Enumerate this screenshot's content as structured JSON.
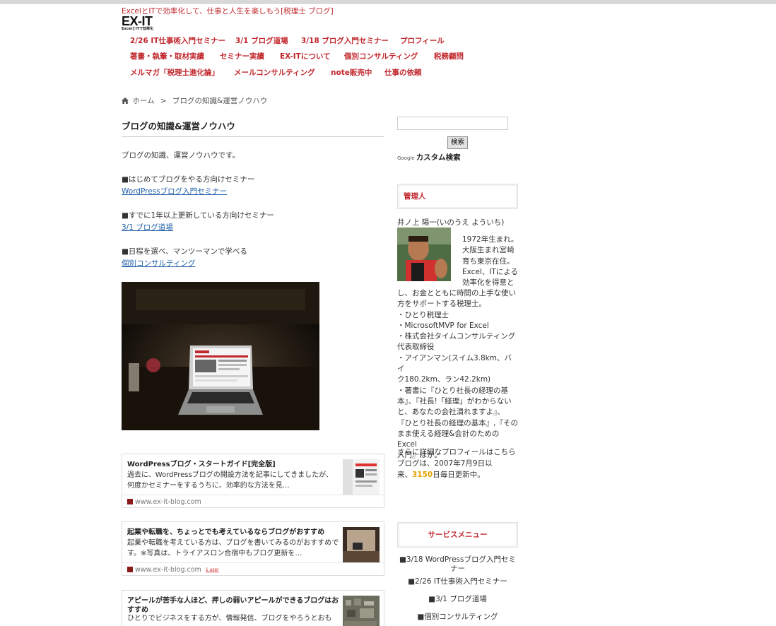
{
  "site": {
    "tagline": "ExcelとITで効率化して、仕事と人生を楽しもう[税理士 ブログ]",
    "logo_main": "EX-IT",
    "logo_sub": "ExcelとITで効率化"
  },
  "nav": {
    "row1": [
      "2/26 IT仕事術入門セミナー",
      "3/1 ブログ道場",
      "3/18 ブログ入門セミナー",
      "プロフィール"
    ],
    "row2": [
      "著書・執筆・取材実績",
      "セミナー実績",
      "EX-ITについて",
      "個別コンサルティング",
      "税務顧問"
    ],
    "row3": [
      "メルマガ「税理士進化論」",
      "メールコンサルティング",
      "note販売中",
      "仕事の依頼"
    ]
  },
  "breadcrumb": {
    "home": "ホーム",
    "separator": ">",
    "current": "ブログの知識&運営ノウハウ"
  },
  "article": {
    "title": "ブログの知識&運営ノウハウ",
    "intro": "ブログの知識、運営ノウハウです。",
    "sections": [
      {
        "heading": "■はじめてブログをやる方向けセミナー",
        "link": "WordPressブログ入門セミナー"
      },
      {
        "heading": "■すでに1年以上更新している方向けセミナー",
        "link": "3/1 ブログ道場"
      },
      {
        "heading": "■日程を選べ、マンツーマンで学べる",
        "link": "個別コンサルティング"
      }
    ]
  },
  "cards": [
    {
      "title": "WordPressブログ・スタートガイド[完全版]",
      "desc": "過去に、WordPressブログの開設方法を記事にしてきましたが、何度かセミナーをするうちに、効率的な方法を見…",
      "url": "www.ex-it-blog.com",
      "badge": ""
    },
    {
      "title": "起業や転職を、ちょっとでも考えているならブログがおすすめ",
      "desc": "起業や転職を考えている方は、ブログを書いてみるのがおすすめです。※写真は、トライアスロン合宿中もブログ更新を…",
      "url": "www.ex-it-blog.com",
      "badge": "1 user"
    },
    {
      "title": "アピールが苦手な人ほど、押しの弱いアピールができるブログはおすすめ",
      "desc": "ひとりでビジネスをする方が、情報発信、ブログをやろうとおも",
      "url": "",
      "badge": ""
    }
  ],
  "sidebar": {
    "search_button": "検索",
    "search_placeholder": "",
    "custom_search_logo": "Google",
    "custom_search_label": "カスタム検索",
    "admin_title": "管理人",
    "admin_name": "井ノ上 陽一(いのうえ よういち)",
    "profile_lines_right": [
      "1972年生まれ。",
      "大阪生まれ宮崎",
      "育ち東京在住。",
      "Excel、ITによる",
      "効率化を得意と"
    ],
    "profile_lines_full": [
      "し、お金とともに時間の上手な使い",
      "方をサポートする税理士。",
      "・ひとり税理士",
      "・MicrosoftMVP for Excel",
      "・株式会社タイムコンサルティング",
      "代表取締役",
      "・アイアンマン(スイム3.8km、バイ",
      "ク180.2km、ラン42.2km)",
      "・著書に『ひとり社長の経理の基",
      "本』、『社長!「経理」がわからない",
      "と、あなたの会社潰れますよ』、",
      "『ひとり社長の経理の基本』,『その",
      "まま使える経理&会計のためのExcel",
      "入門』ほか。"
    ],
    "more_profile": "さらに詳細なプロフィールはこちら",
    "blog_prefix": "ブログは、2007年7月9日以",
    "blog_mid": "来、",
    "blog_days": "3150",
    "blog_suffix": "日毎日更新中。",
    "service_title": "サービスメニュー",
    "services": [
      "■3/18 WordPressブログ入門セミナー",
      "■2/26 IT仕事術入門セミナー",
      "■3/1 ブログ道場",
      "■個別コンサルティング"
    ]
  }
}
